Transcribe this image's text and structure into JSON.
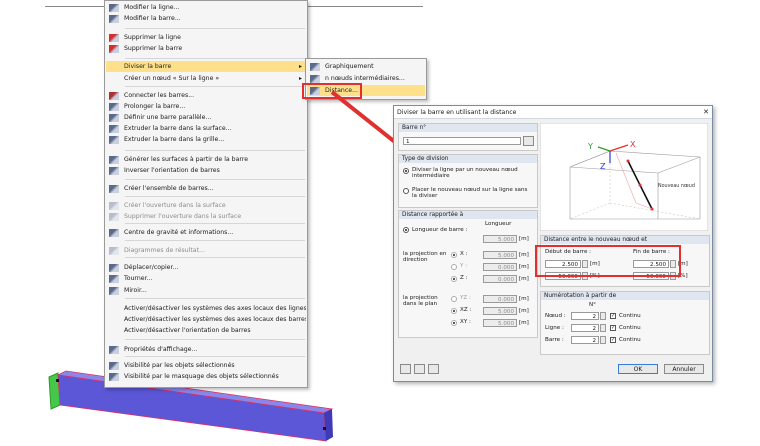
{
  "context_menu": {
    "items": [
      {
        "label": "Modifier la ligne...",
        "icon": "edit-line-icon",
        "disabled": false
      },
      {
        "label": "Modifier la barre...",
        "icon": "edit-member-icon",
        "disabled": false
      },
      {
        "label": "Supprimer la ligne",
        "icon": "delete-line-icon",
        "disabled": false
      },
      {
        "label": "Supprimer la barre",
        "icon": "delete-member-icon",
        "disabled": false
      },
      {
        "label": "Diviser la barre",
        "icon": "",
        "disabled": false,
        "highlight": true,
        "submenu": true
      },
      {
        "label": "Créer un nœud « Sur la ligne »",
        "icon": "",
        "disabled": false,
        "submenu": true
      },
      {
        "label": "Connecter les barres...",
        "icon": "connect-members-icon",
        "disabled": false
      },
      {
        "label": "Prolonger la barre...",
        "icon": "extend-member-icon",
        "disabled": false
      },
      {
        "label": "Définir une barre parallèle...",
        "icon": "parallel-member-icon",
        "disabled": false
      },
      {
        "label": "Extruder la barre dans la surface...",
        "icon": "extrude-surface-icon",
        "disabled": false
      },
      {
        "label": "Extruder la barre dans la grille...",
        "icon": "extrude-grid-icon",
        "disabled": false
      },
      {
        "label": "Générer les surfaces à partir de la barre",
        "icon": "generate-surfaces-icon",
        "disabled": false
      },
      {
        "label": "Inverser l'orientation de barres",
        "icon": "reverse-orientation-icon",
        "disabled": false
      },
      {
        "label": "Créer l'ensemble de barres...",
        "icon": "member-set-icon",
        "disabled": false
      },
      {
        "label": "Créer l'ouverture dans la surface",
        "icon": "opening-icon",
        "disabled": true
      },
      {
        "label": "Supprimer l'ouverture dans la surface",
        "icon": "delete-opening-icon",
        "disabled": true
      },
      {
        "label": "Centre de gravité et informations...",
        "icon": "centroid-icon",
        "disabled": false
      },
      {
        "label": "Diagrammes de résultat...",
        "icon": "result-diagram-icon",
        "disabled": true
      },
      {
        "label": "Déplacer/copier...",
        "icon": "move-copy-icon",
        "disabled": false
      },
      {
        "label": "Tourner...",
        "icon": "rotate-icon",
        "disabled": false
      },
      {
        "label": "Miroir...",
        "icon": "mirror-icon",
        "disabled": false
      },
      {
        "label": "Activer/désactiver les systèmes des axes locaux des lignes",
        "icon": "",
        "disabled": false
      },
      {
        "label": "Activer/désactiver les systèmes des axes locaux des barres",
        "icon": "",
        "disabled": false
      },
      {
        "label": "Activer/désactiver l'orientation de barres",
        "icon": "",
        "disabled": false
      },
      {
        "label": "Propriétés d'affichage...",
        "icon": "display-properties-icon",
        "disabled": false
      },
      {
        "label": "Visibilité par les objets sélectionnés",
        "icon": "visibility-selected-icon",
        "disabled": false
      },
      {
        "label": "Visibilité par le masquage des objets sélectionnés",
        "icon": "visibility-hide-icon",
        "disabled": false
      }
    ]
  },
  "submenu": {
    "items": [
      {
        "label": "Graphiquement",
        "icon": "graphic-divide-icon"
      },
      {
        "label": "n nœuds intermédiaires...",
        "icon": "n-nodes-icon"
      },
      {
        "label": "Distance...",
        "icon": "distance-icon",
        "highlight": true
      }
    ]
  },
  "dialog": {
    "title": "Diviser la barre en utilisant la distance",
    "close_label": "✕",
    "member_no": {
      "label": "Barre n°",
      "value": "1"
    },
    "division_type": {
      "title": "Type de division",
      "opt1": "Diviser la ligne par un nouveau nœud intermédiaire",
      "opt2": "Placer le nouveau nœud sur la ligne sans la diviser"
    },
    "distance_ref": {
      "title": "Distance rapportée à",
      "member_length_label": "Longueur de barre :",
      "length_header": "Longueur",
      "length_value": "5.000",
      "unit_m": "[m]",
      "proj_direction_label": "la projection en direction",
      "proj_plane_label": "la projection dans le plan",
      "axes_dir": [
        {
          "axis": "X :",
          "value": "5.000",
          "on": true
        },
        {
          "axis": "Y :",
          "value": "0.000",
          "on": false
        },
        {
          "axis": "Z :",
          "value": "0.000",
          "on": true
        }
      ],
      "axes_plane": [
        {
          "axis": "YZ :",
          "value": "0.000",
          "on": false
        },
        {
          "axis": "XZ :",
          "value": "5.000",
          "on": true
        },
        {
          "axis": "XY :",
          "value": "5.000",
          "on": true
        }
      ]
    },
    "distance_group": {
      "title": "Distance entre le nouveau nœud et",
      "start_label": "Début de barre :",
      "end_label": "Fin de barre :",
      "start_m": "2.500",
      "end_m": "2.500",
      "start_pct": "50.000",
      "end_pct": "50.000",
      "unit_m": "[m]",
      "unit_pct": "[%]"
    },
    "numbering": {
      "title": "Numérotation à partir de",
      "no_header": "N°",
      "rows": [
        {
          "label": "Nœud :",
          "value": "2"
        },
        {
          "label": "Ligne :",
          "value": "2"
        },
        {
          "label": "Barre :",
          "value": "2"
        }
      ],
      "check_label": "Continu"
    },
    "diagram": {
      "label_x": "X",
      "label_y": "Y",
      "label_z": "Z",
      "new_node": "Nouveau nœud"
    },
    "ok_label": "OK",
    "cancel_label": "Annuler"
  },
  "colors": {
    "menu_highlight": "#ffe08a",
    "callout": "#e03030",
    "member": "#5b57d6",
    "support": "#45c84a"
  }
}
